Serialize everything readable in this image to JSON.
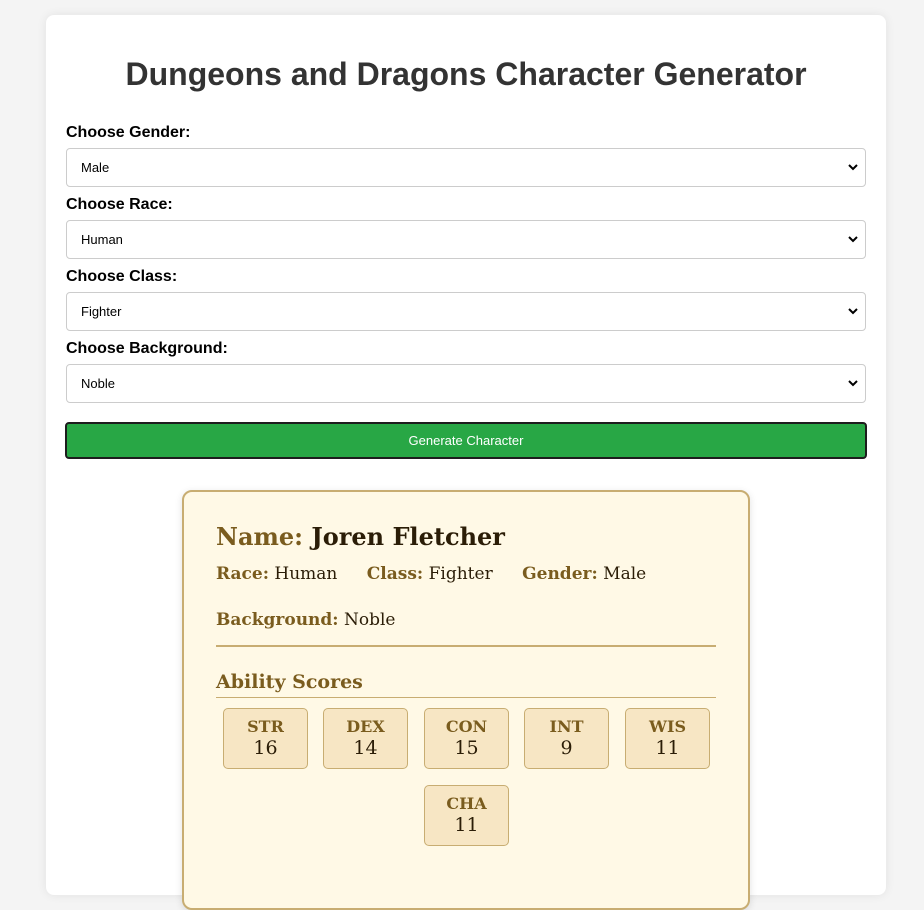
{
  "page": {
    "title": "Dungeons and Dragons Character Generator"
  },
  "form": {
    "gender": {
      "label": "Choose Gender:",
      "value": "Male"
    },
    "race": {
      "label": "Choose Race:",
      "value": "Human"
    },
    "class": {
      "label": "Choose Class:",
      "value": "Fighter"
    },
    "background": {
      "label": "Choose Background:",
      "value": "Noble"
    },
    "generate_label": "Generate Character"
  },
  "character": {
    "name_label": "Name:",
    "name": "Joren Fletcher",
    "race_label": "Race:",
    "race": "Human",
    "class_label": "Class:",
    "class": "Fighter",
    "gender_label": "Gender:",
    "gender": "Male",
    "background_label": "Background:",
    "background": "Noble",
    "abilities_heading": "Ability Scores",
    "abilities": [
      {
        "abbr": "STR",
        "score": "16"
      },
      {
        "abbr": "DEX",
        "score": "14"
      },
      {
        "abbr": "CON",
        "score": "15"
      },
      {
        "abbr": "INT",
        "score": "9"
      },
      {
        "abbr": "WIS",
        "score": "11"
      },
      {
        "abbr": "CHA",
        "score": "11"
      }
    ]
  },
  "colors": {
    "button": "#28a745",
    "sheet_bg": "#fff9e6",
    "sheet_border": "#c8ad72",
    "accent_brown": "#7a5c1e"
  },
  "icons": {
    "select_arrow": "chevron-down-icon"
  }
}
